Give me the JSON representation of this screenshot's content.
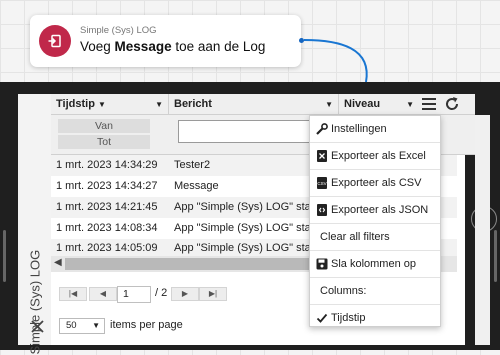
{
  "node": {
    "subtitle": "Simple (Sys) LOG",
    "title_before": "Voeg ",
    "title_bold": "Message",
    "title_after": " toe aan de Log",
    "accent": "#c0284a"
  },
  "panel": {
    "side_label": "Simple (Sys) LOG"
  },
  "table": {
    "columns": [
      "Tijdstip",
      "Bericht",
      "Niveau"
    ],
    "sort_indicator": "▼",
    "filter_from": "Van",
    "filter_to": "Tot",
    "rows": [
      {
        "time": "1 mrt. 2023 14:34:29",
        "message": "Tester2"
      },
      {
        "time": "1 mrt. 2023 14:34:27",
        "message": "Message"
      },
      {
        "time": "1 mrt. 2023 14:21:45",
        "message": "App \"Simple (Sys) LOG\" started."
      },
      {
        "time": "1 mrt. 2023 14:08:34",
        "message": "App \"Simple (Sys) LOG\" started."
      },
      {
        "time": "1 mrt. 2023 14:05:09",
        "message": "App \"Simple (Sys) LOG\" started."
      }
    ]
  },
  "pagination": {
    "current_page": "1",
    "total_pages": "/ 2",
    "page_size": "50",
    "items_per_page_label": "items per page"
  },
  "menu": {
    "items": [
      {
        "label": "Instellingen",
        "icon": "wrench-icon"
      },
      {
        "label": "Exporteer als Excel",
        "icon": "excel-file-icon"
      },
      {
        "label": "Exporteer als CSV",
        "icon": "csv-file-icon"
      },
      {
        "label": "Exporteer als JSON",
        "icon": "json-file-icon"
      },
      {
        "label": "Clear all filters",
        "icon": ""
      },
      {
        "label": "Sla kolommen op",
        "icon": "save-icon"
      },
      {
        "label": "Columns:",
        "icon": ""
      },
      {
        "label": "Tijdstip",
        "icon": "checkmark-icon"
      }
    ]
  }
}
